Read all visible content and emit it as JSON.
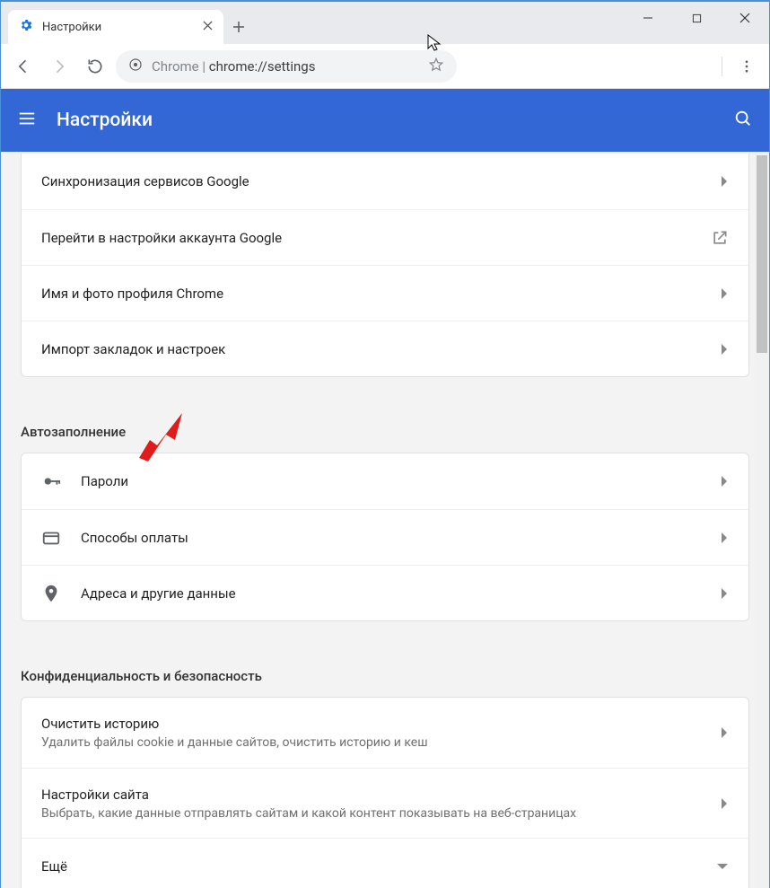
{
  "window": {
    "tab_title": "Настройки"
  },
  "omnibox": {
    "origin_label": "Chrome",
    "path": "chrome://settings"
  },
  "header": {
    "title": "Настройки"
  },
  "group_people": {
    "items": [
      {
        "label": "Синхронизация сервисов Google",
        "action": "chevron"
      },
      {
        "label": "Перейти в настройки аккаунта Google",
        "action": "external"
      },
      {
        "label": "Имя и фото профиля Chrome",
        "action": "chevron"
      },
      {
        "label": "Импорт закладок и настроек",
        "action": "chevron"
      }
    ]
  },
  "group_autofill": {
    "title": "Автозаполнение",
    "items": [
      {
        "icon": "key-icon",
        "label": "Пароли"
      },
      {
        "icon": "card-icon",
        "label": "Способы оплаты"
      },
      {
        "icon": "place-icon",
        "label": "Адреса и другие данные"
      }
    ]
  },
  "group_privacy": {
    "title": "Конфиденциальность и безопасность",
    "items": [
      {
        "label": "Очистить историю",
        "sub": "Удалить файлы cookie и данные сайтов, очистить историю и кеш",
        "action": "chevron"
      },
      {
        "label": "Настройки сайта",
        "sub": "Выбрать, какие данные отправлять сайтам и какой контент показывать на веб-страницах",
        "action": "chevron"
      },
      {
        "label": "Ещё",
        "action": "chevron-down"
      }
    ]
  }
}
